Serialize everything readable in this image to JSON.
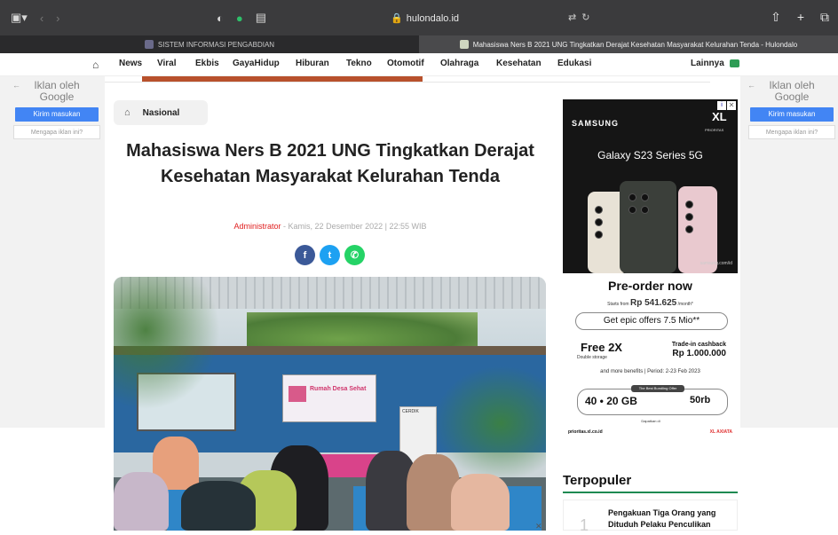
{
  "browser": {
    "url": "hulondalo.id",
    "tabs": [
      {
        "label": "SISTEM INFORMASI PENGABDIAN",
        "active": false
      },
      {
        "label": "Mahasiswa Ners B 2021 UNG Tingkatkan Derajat Kesehatan Masyarakat Kelurahan Tenda - Hulondalo",
        "active": true
      }
    ]
  },
  "nav": {
    "items": [
      "News",
      "Viral",
      "Ekbis",
      "GayaHidup",
      "Hiburan",
      "Tekno",
      "Otomotif",
      "Olahraga",
      "Kesehatan",
      "Edukasi"
    ],
    "more_label": "Lainnya"
  },
  "google_ad": {
    "label": "Iklan oleh Google",
    "feedback_button": "Kirim masukan",
    "why_button": "Mengapa iklan ini?"
  },
  "article": {
    "category": "Nasional",
    "title": "Mahasiswa Ners B 2021 UNG Tingkatkan Derajat Kesehatan Masyarakat Kelurahan Tenda",
    "author": "Administrator",
    "date": "Kamis, 22 Desember 2022 | 22:55 WIB",
    "poster_text": "Rumah Desa Sehat",
    "banner_text": "CERDIK"
  },
  "side_ad": {
    "brand": "SAMSUNG",
    "partner": "XL",
    "partner_sub": "PRIORITAS",
    "product": "Galaxy S23 Series 5G",
    "site": "samsung.com/id",
    "preorder": "Pre-order now",
    "starts_from": "Starts from",
    "price": "Rp 541.625",
    "per_month": "/month*",
    "epic_offer": "Get epic offers",
    "epic_value": "7.5 Mio**",
    "free_label": "Free 2X",
    "free_sub": "Double storage",
    "tradein_label": "Trade-in cashback",
    "tradein_value": "Rp 1.000.000",
    "more_benefits": "and more benefits | Period: 2-23 Feb 2023",
    "best_offer": "The Best Bundling Offer",
    "kuota_label": "Kuota Data",
    "kuota_value": "40 • 20 GB",
    "price2": "50rb",
    "available": "Dapatkan di",
    "prioritas": "prioritas.xl.co.id",
    "axiata": "XL AXIATA"
  },
  "sidebar": {
    "heading": "Terpopuler",
    "popular": [
      {
        "rank": "1",
        "title": "Pengakuan Tiga Orang yang Dituduh Pelaku Penculikan"
      }
    ]
  }
}
